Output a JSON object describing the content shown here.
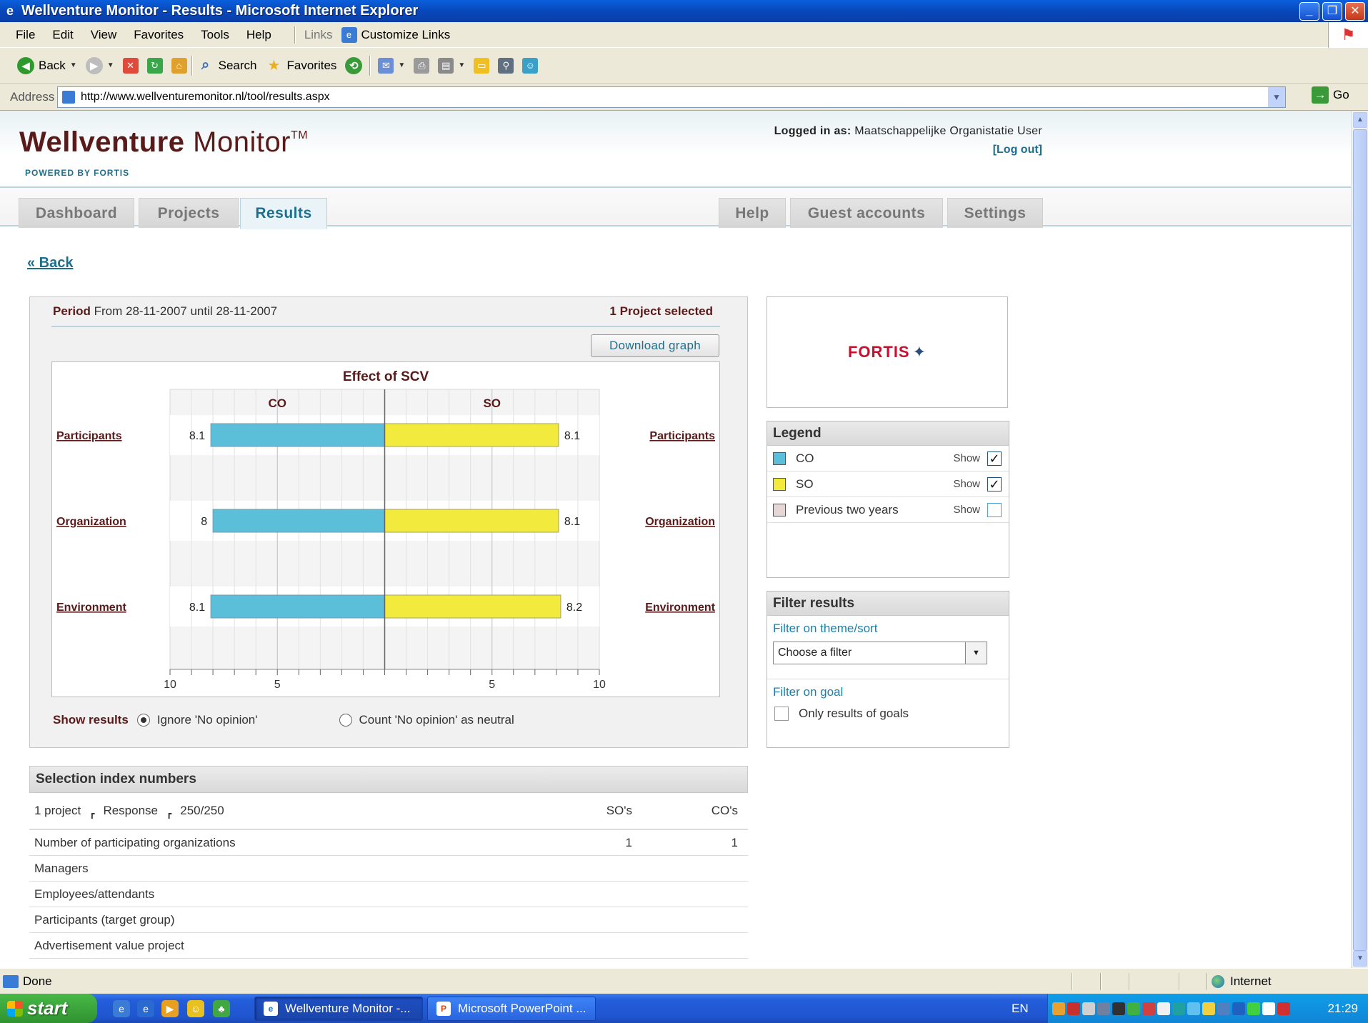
{
  "window": {
    "title": "Wellventure Monitor - Results - Microsoft Internet Explorer",
    "icon": "ie-icon",
    "minimize": "_",
    "maximize": "❐",
    "close": "✕"
  },
  "menu": {
    "items": [
      "File",
      "Edit",
      "View",
      "Favorites",
      "Tools",
      "Help"
    ],
    "links_label": "Links",
    "customize_links": "Customize Links"
  },
  "toolbar": {
    "back": "Back",
    "search": "Search",
    "favorites": "Favorites"
  },
  "address": {
    "label": "Address",
    "url": "http://www.wellventuremonitor.nl/tool/results.aspx",
    "go": "Go"
  },
  "header": {
    "logo_bold": "Wellventure",
    "logo_light": "Monitor",
    "logo_tm": "TM",
    "powered_by": "POWERED BY FORTIS",
    "logged_in_label": "Logged in as:",
    "logged_in_user": "Maatschappelijke Organistatie User",
    "logout": "[Log out]"
  },
  "nav": {
    "tabs_left": [
      "Dashboard",
      "Projects",
      "Results"
    ],
    "active": "Results",
    "tabs_right": [
      "Help",
      "Guest accounts",
      "Settings"
    ]
  },
  "back_link": "« Back",
  "graph_panel": {
    "period_label": "Period",
    "period_value": "From 28-11-2007 until 28-11-2007",
    "projects_selected": "1 Project selected",
    "download_button": "Download graph",
    "show_results_label": "Show results",
    "option_ignore": "Ignore 'No opinion'",
    "option_neutral": "Count 'No opinion' as neutral",
    "selected_option": "ignore"
  },
  "chart_data": {
    "type": "bar",
    "orientation": "horizontal-diverging",
    "title": "Effect of SCV",
    "categories": [
      "Participants",
      "Organization",
      "Environment"
    ],
    "series": [
      {
        "name": "CO",
        "values": [
          8.1,
          8,
          8.1
        ],
        "side": "left",
        "color": "#5bbfda"
      },
      {
        "name": "SO",
        "values": [
          8.1,
          8.1,
          8.2
        ],
        "side": "right",
        "color": "#f2ea3c"
      }
    ],
    "value_labels": {
      "CO": [
        "8.1",
        "8",
        "8.1"
      ],
      "SO": [
        "8.1",
        "8.1",
        "8.2"
      ]
    },
    "xlim": [
      0,
      10
    ],
    "tick_labels": [
      "10",
      "5",
      "5",
      "10"
    ],
    "grid": true
  },
  "fortis_logo": {
    "text": "FORTIS",
    "icon": "star-icon"
  },
  "legend": {
    "title": "Legend",
    "show_label": "Show",
    "items": [
      {
        "label": "CO",
        "color": "#5bbfda",
        "checked": true
      },
      {
        "label": "SO",
        "color": "#f2ea3c",
        "checked": true
      },
      {
        "label": "Previous two years",
        "color": "#e6d6d6",
        "checked": false
      }
    ]
  },
  "filter": {
    "title": "Filter results",
    "theme_label": "Filter on theme/sort",
    "theme_value": "Choose a filter",
    "goal_label": "Filter on goal",
    "goal_checkbox": "Only results of goals"
  },
  "selection": {
    "title": "Selection index numbers",
    "summary_projects": "1 project",
    "summary_response_label": "Response",
    "summary_response_value": "250/250",
    "col_so": "SO's",
    "col_co": "CO's",
    "rows": [
      {
        "label": "Number of participating organizations",
        "so": "1",
        "co": "1"
      },
      {
        "label": "Managers",
        "so": "",
        "co": ""
      },
      {
        "label": "Employees/attendants",
        "so": "",
        "co": ""
      },
      {
        "label": "Participants (target group)",
        "so": "",
        "co": ""
      },
      {
        "label": "Advertisement value project",
        "so": "",
        "co": ""
      }
    ]
  },
  "status": {
    "text": "Done",
    "zone": "Internet"
  },
  "taskbar": {
    "start": "start",
    "tasks": [
      "Wellventure Monitor -...",
      "Microsoft PowerPoint ..."
    ],
    "language": "EN",
    "clock": "21:29"
  },
  "colors": {
    "brand_maroon": "#5a1a1a",
    "brand_teal": "#1e6f8e",
    "co": "#5bbfda",
    "so": "#f2ea3c"
  }
}
